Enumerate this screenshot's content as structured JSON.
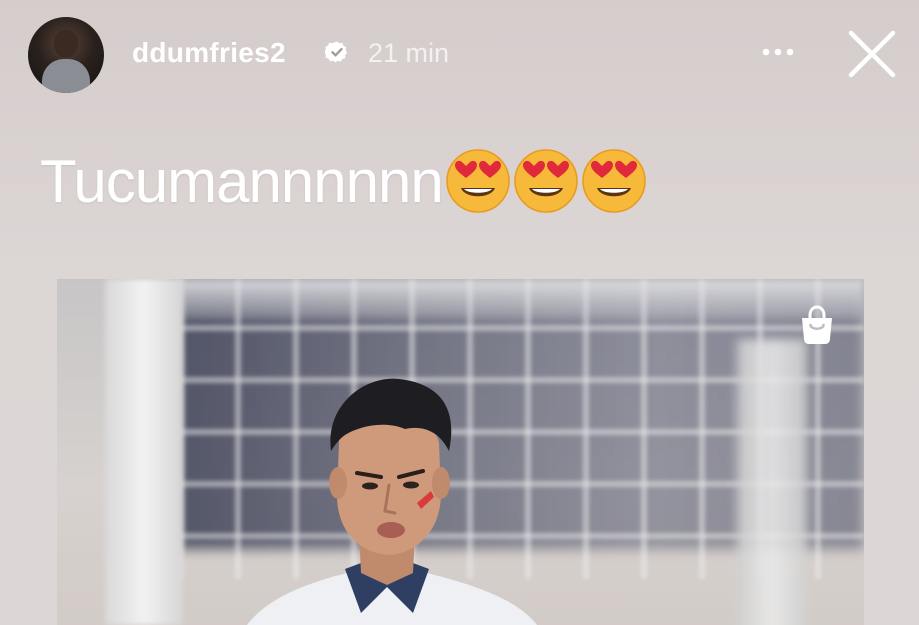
{
  "story": {
    "username": "ddumfries2",
    "time": "21 min",
    "verified": true,
    "icons": {
      "avatar": "profile-avatar",
      "verified": "verified-badge-icon",
      "more": "more-options-icon",
      "close": "close-icon",
      "shop": "shopping-bag-icon"
    },
    "caption": "Tucumannnnnn",
    "caption_emojis": [
      "😍",
      "😍",
      "😍"
    ]
  },
  "colors": {
    "background": "#d8d1d0",
    "text": "#ffffff",
    "emoji": "#f6b93a",
    "heart": "#e02a3b"
  }
}
